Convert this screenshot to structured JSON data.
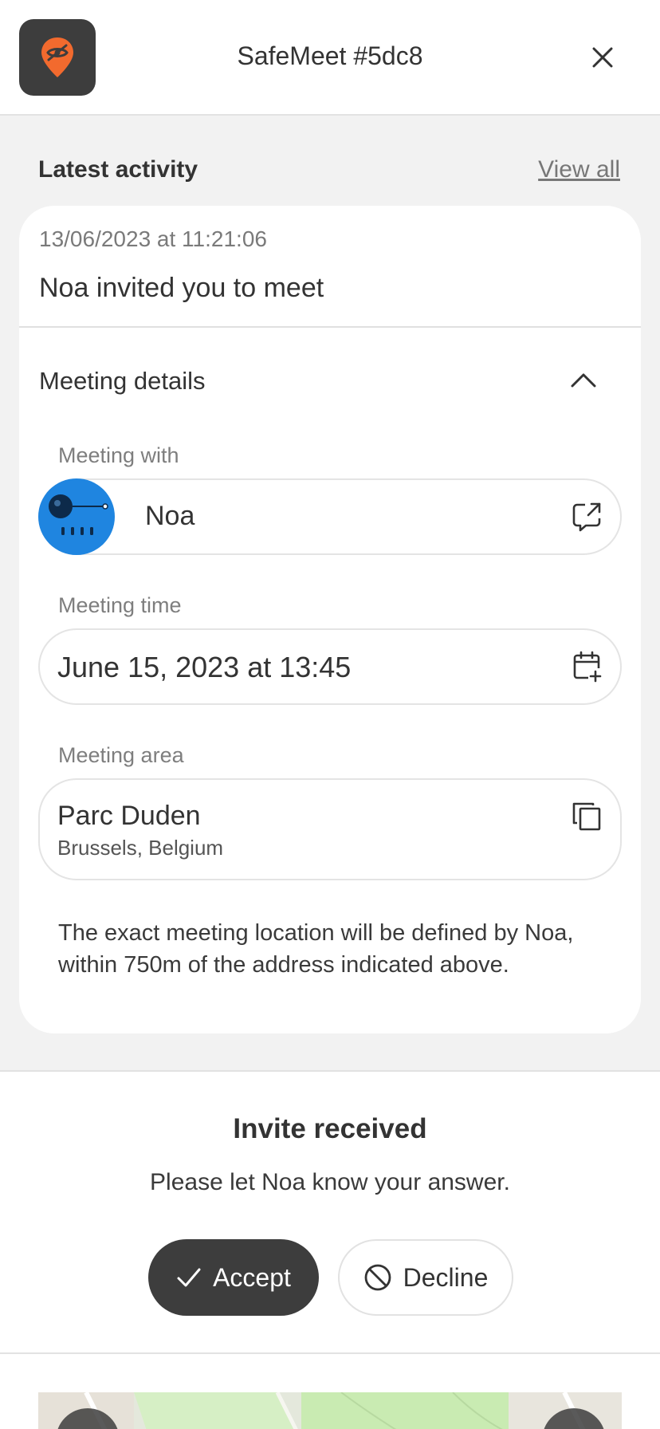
{
  "header": {
    "title": "SafeMeet #5dc8",
    "brand_color": "#f26a2e"
  },
  "activity": {
    "title": "Latest activity",
    "view_all": "View all"
  },
  "event": {
    "timestamp": "13/06/2023 at 11:21:06",
    "message": "Noa invited you to meet"
  },
  "details": {
    "title": "Meeting details",
    "with_label": "Meeting with",
    "with_name": "Noa",
    "time_label": "Meeting time",
    "time_value": "June 15, 2023 at 13:45",
    "area_label": "Meeting area",
    "area_name": "Parc Duden",
    "area_city": "Brussels, Belgium",
    "note": "The exact meeting location will be defined by Noa, within 750m of the address indicated above."
  },
  "invite": {
    "title": "Invite received",
    "subtitle": "Please let Noa know your answer.",
    "accept_label": "Accept",
    "decline_label": "Decline"
  },
  "icons": {
    "logo": "location-pin-hidden-icon",
    "close": "close-icon",
    "chevron": "chevron-up-icon",
    "open": "open-external-icon",
    "calendar": "calendar-add-icon",
    "copy": "copy-icon",
    "check": "check-icon",
    "decline": "prohibited-icon"
  }
}
